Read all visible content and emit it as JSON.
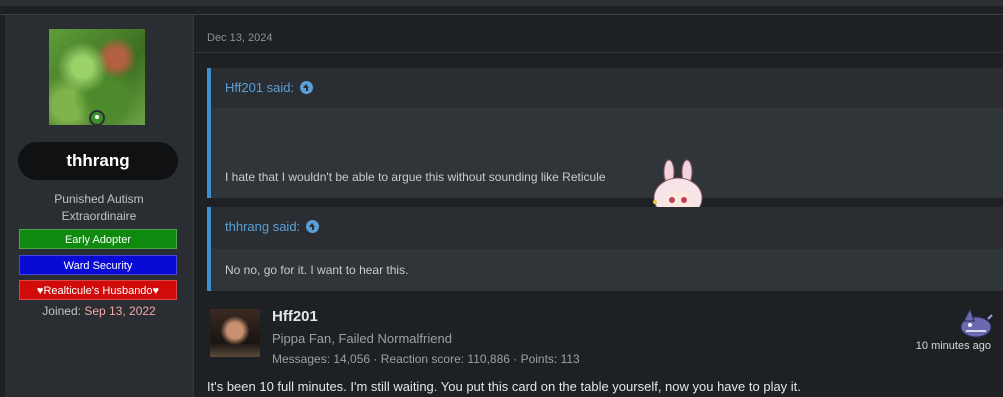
{
  "sidebar": {
    "username": "thhrang",
    "user_title_line1": "Punished Autism",
    "user_title_line2": "Extraordinaire",
    "banners": [
      "Early Adopter",
      "Ward Security",
      "♥Realticule's Husbando♥"
    ],
    "joined_label": "Joined:",
    "joined_date": "Sep 13, 2022",
    "colors": {
      "early_adopter": "#0f8a0f",
      "ward_security": "#0a0ad6",
      "husbando": "#d10a0a"
    }
  },
  "post": {
    "date": "Dec 13, 2024",
    "quotes": [
      {
        "author": "Hff201 said:",
        "text": "I hate that I wouldn't be able to argue this without sounding like Reticule",
        "emote": "bunny-girl-emote"
      },
      {
        "author": "thhrang said:",
        "text": "No no, go for it. I want to hear this."
      }
    ]
  },
  "reply": {
    "name": "Hff201",
    "title": "Pippa Fan, Failed Normalfriend",
    "stats": "Messages: 14,056 · Reaction score: 110,886 · Points: 113",
    "time": "10 minutes ago",
    "text": "It's been 10 full minutes. I'm still waiting. You put this card on the table yourself, now you have to play it."
  },
  "accent_color": "#3f8fcf"
}
